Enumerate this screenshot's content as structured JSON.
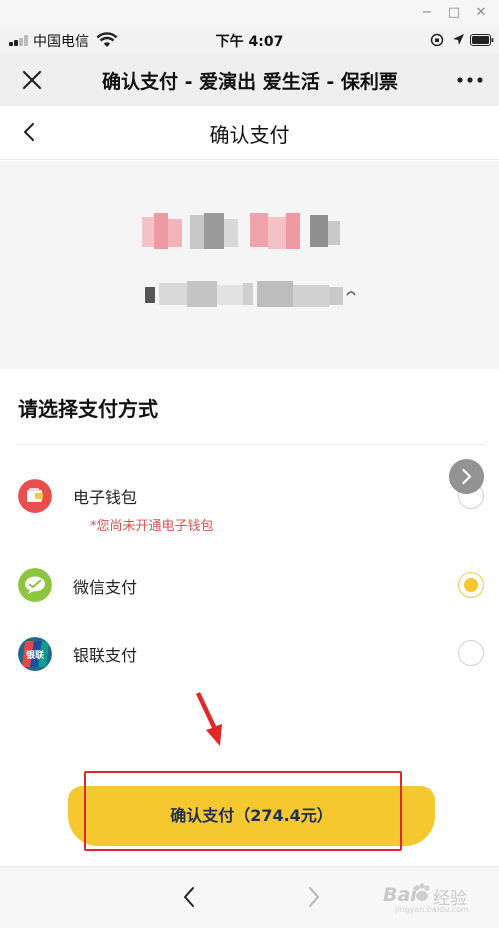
{
  "status_bar": {
    "carrier": "中国电信",
    "time": "下午 4:07"
  },
  "nav": {
    "title": "确认支付 - 爱演出 爱生活 - 保利票"
  },
  "page": {
    "title": "确认支付"
  },
  "payment": {
    "section_title": "请选择支付方式",
    "methods": [
      {
        "label": "电子钱包",
        "note": "*您尚未开通电子钱包",
        "selected": false,
        "icon": "wallet-icon",
        "color": "#e94e4e"
      },
      {
        "label": "微信支付",
        "selected": true,
        "icon": "wechat-pay-icon",
        "color": "#8cc63f"
      },
      {
        "label": "银联支付",
        "selected": false,
        "icon": "unionpay-icon",
        "color": "#1d6b8c"
      }
    ],
    "unionpay_glyph": "银联"
  },
  "confirm": {
    "label": "确认支付（274.4元）"
  },
  "watermark": {
    "brand_a": "Bai",
    "brand_b": "经验",
    "url": "jingyan.baidu.com"
  },
  "colors": {
    "accent": "#f5c82f",
    "button_text": "#1e2f4f",
    "note_red": "#d9534f",
    "annotation_red": "#e02828"
  }
}
